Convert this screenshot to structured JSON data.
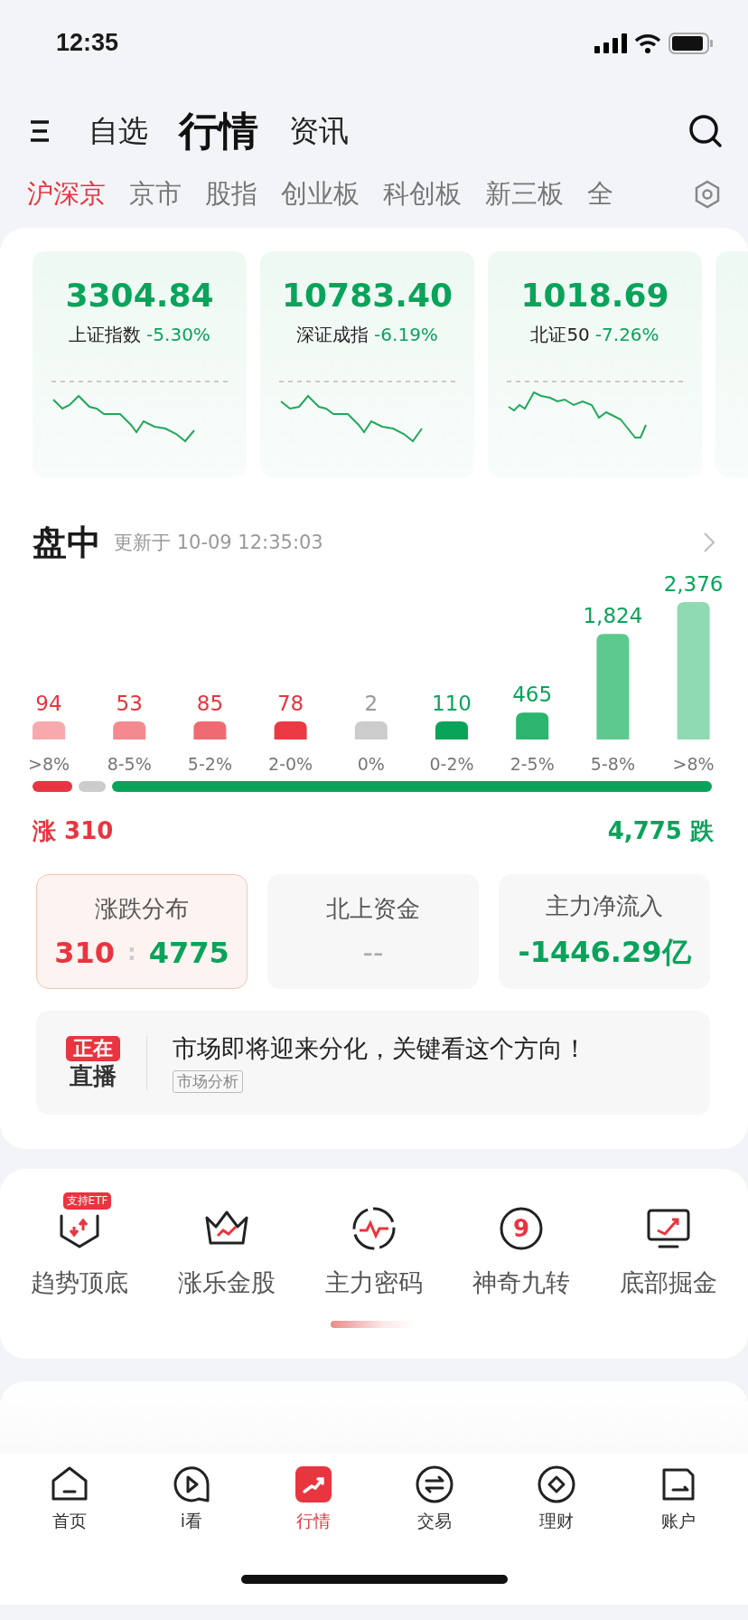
{
  "status_bar": {
    "time": "12:35"
  },
  "header": {
    "tabs": [
      {
        "label": "自选",
        "selected": false
      },
      {
        "label": "行情",
        "selected": true
      },
      {
        "label": "资讯",
        "selected": false
      }
    ]
  },
  "markets": [
    {
      "label": "沪深京",
      "selected": true
    },
    {
      "label": "京市",
      "selected": false
    },
    {
      "label": "股指",
      "selected": false
    },
    {
      "label": "创业板",
      "selected": false
    },
    {
      "label": "科创板",
      "selected": false
    },
    {
      "label": "新三板",
      "selected": false
    },
    {
      "label": "全",
      "selected": false
    }
  ],
  "indices": [
    {
      "value": "3304.84",
      "name": "上证指数",
      "change": "-5.30%"
    },
    {
      "value": "10783.40",
      "name": "深证成指",
      "change": "-6.19%"
    },
    {
      "value": "1018.69",
      "name": "北证50",
      "change": "-7.26%"
    }
  ],
  "intraday": {
    "title": "盘中",
    "updated": "更新于 10-09 12:35:03",
    "buckets": [
      {
        "range": ">8%",
        "count": "94",
        "color": "#f7a9ae",
        "kind": "up"
      },
      {
        "range": "8-5%",
        "count": "53",
        "color": "#f48a90",
        "kind": "up"
      },
      {
        "range": "5-2%",
        "count": "85",
        "color": "#f06a71",
        "kind": "up"
      },
      {
        "range": "2-0%",
        "count": "78",
        "color": "#ea3a44",
        "kind": "up"
      },
      {
        "range": "0%",
        "count": "2",
        "color": "#cccccc",
        "kind": "flat"
      },
      {
        "range": "0-2%",
        "count": "110",
        "color": "#0aa35a",
        "kind": "down"
      },
      {
        "range": "2-5%",
        "count": "465",
        "color": "#2bb56f",
        "kind": "down"
      },
      {
        "range": "5-8%",
        "count": "1,824",
        "color": "#5ec98f",
        "kind": "down"
      },
      {
        "range": ">8%",
        "count": "2,376",
        "color": "#8fdab2",
        "kind": "down"
      }
    ],
    "rise": "涨 310",
    "fall": "4,775 跌"
  },
  "stats": [
    {
      "title": "涨跌分布",
      "kind": "ratio",
      "up": "310",
      "separator": ":",
      "down": "4775",
      "selected": true
    },
    {
      "title": "北上资金",
      "kind": "empty",
      "value": "--",
      "selected": false
    },
    {
      "title": "主力净流入",
      "kind": "down",
      "value": "-1446.29亿",
      "selected": false
    }
  ],
  "live": {
    "badge_top": "正在",
    "badge_bottom": "直播",
    "headline": "市场即将迎来分化，关键看这个方向！",
    "tag": "市场分析"
  },
  "tools": [
    {
      "label": "趋势顶底",
      "kind": "shield",
      "badge": "支持ETF"
    },
    {
      "label": "涨乐金股",
      "kind": "crown"
    },
    {
      "label": "主力密码",
      "kind": "pulse"
    },
    {
      "label": "神奇九转",
      "kind": "nine",
      "icon_text": "9"
    },
    {
      "label": "底部掘金",
      "kind": "monitor"
    }
  ],
  "nav": [
    {
      "label": "首页",
      "kind": "home",
      "selected": false
    },
    {
      "label": "i看",
      "kind": "play",
      "selected": false
    },
    {
      "label": "行情",
      "kind": "market",
      "selected": true
    },
    {
      "label": "交易",
      "kind": "swap",
      "selected": false
    },
    {
      "label": "理财",
      "kind": "diamond",
      "selected": false
    },
    {
      "label": "账户",
      "kind": "account",
      "selected": false
    }
  ]
}
